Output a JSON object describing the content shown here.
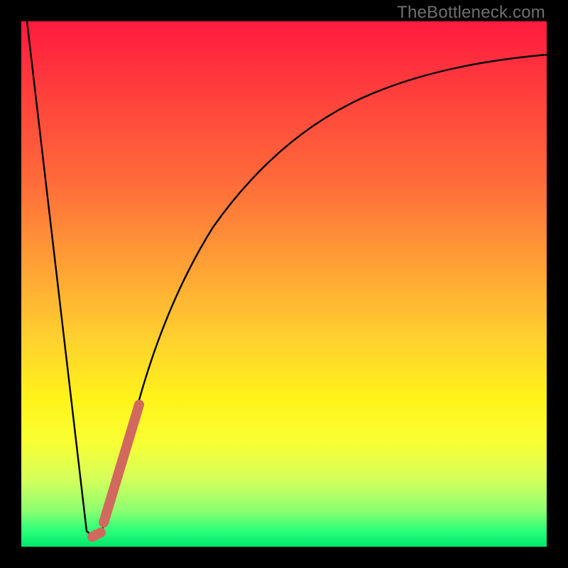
{
  "watermark": "TheBottleneck.com",
  "colors": {
    "background": "#000000",
    "curve_stroke": "#000000",
    "accent_stroke": "#d1695e",
    "gradient_top": "#ff1a3e",
    "gradient_bottom": "#00e66b"
  },
  "chart_data": {
    "type": "line",
    "title": "",
    "xlabel": "",
    "ylabel": "",
    "xlim": [
      0,
      100
    ],
    "ylim": [
      0,
      100
    ],
    "grid": false,
    "series": [
      {
        "name": "bottleneck-curve",
        "x": [
          0,
          3,
          6,
          9,
          12,
          12.5,
          13.5,
          15,
          17,
          20,
          23,
          26,
          30,
          35,
          40,
          45,
          50,
          55,
          60,
          65,
          70,
          75,
          80,
          85,
          90,
          95,
          100
        ],
        "y": [
          100,
          80,
          58,
          35,
          10,
          3,
          1,
          3,
          15,
          25,
          36,
          45,
          55,
          64,
          71,
          77,
          81,
          84,
          86.5,
          88,
          89.5,
          90.5,
          91.4,
          92.2,
          92.8,
          93.3,
          93.7
        ]
      },
      {
        "name": "highlight-segment",
        "x": [
          13.5,
          15,
          17,
          20,
          22
        ],
        "y": [
          1,
          3,
          15,
          25,
          33
        ]
      }
    ],
    "annotations": []
  }
}
